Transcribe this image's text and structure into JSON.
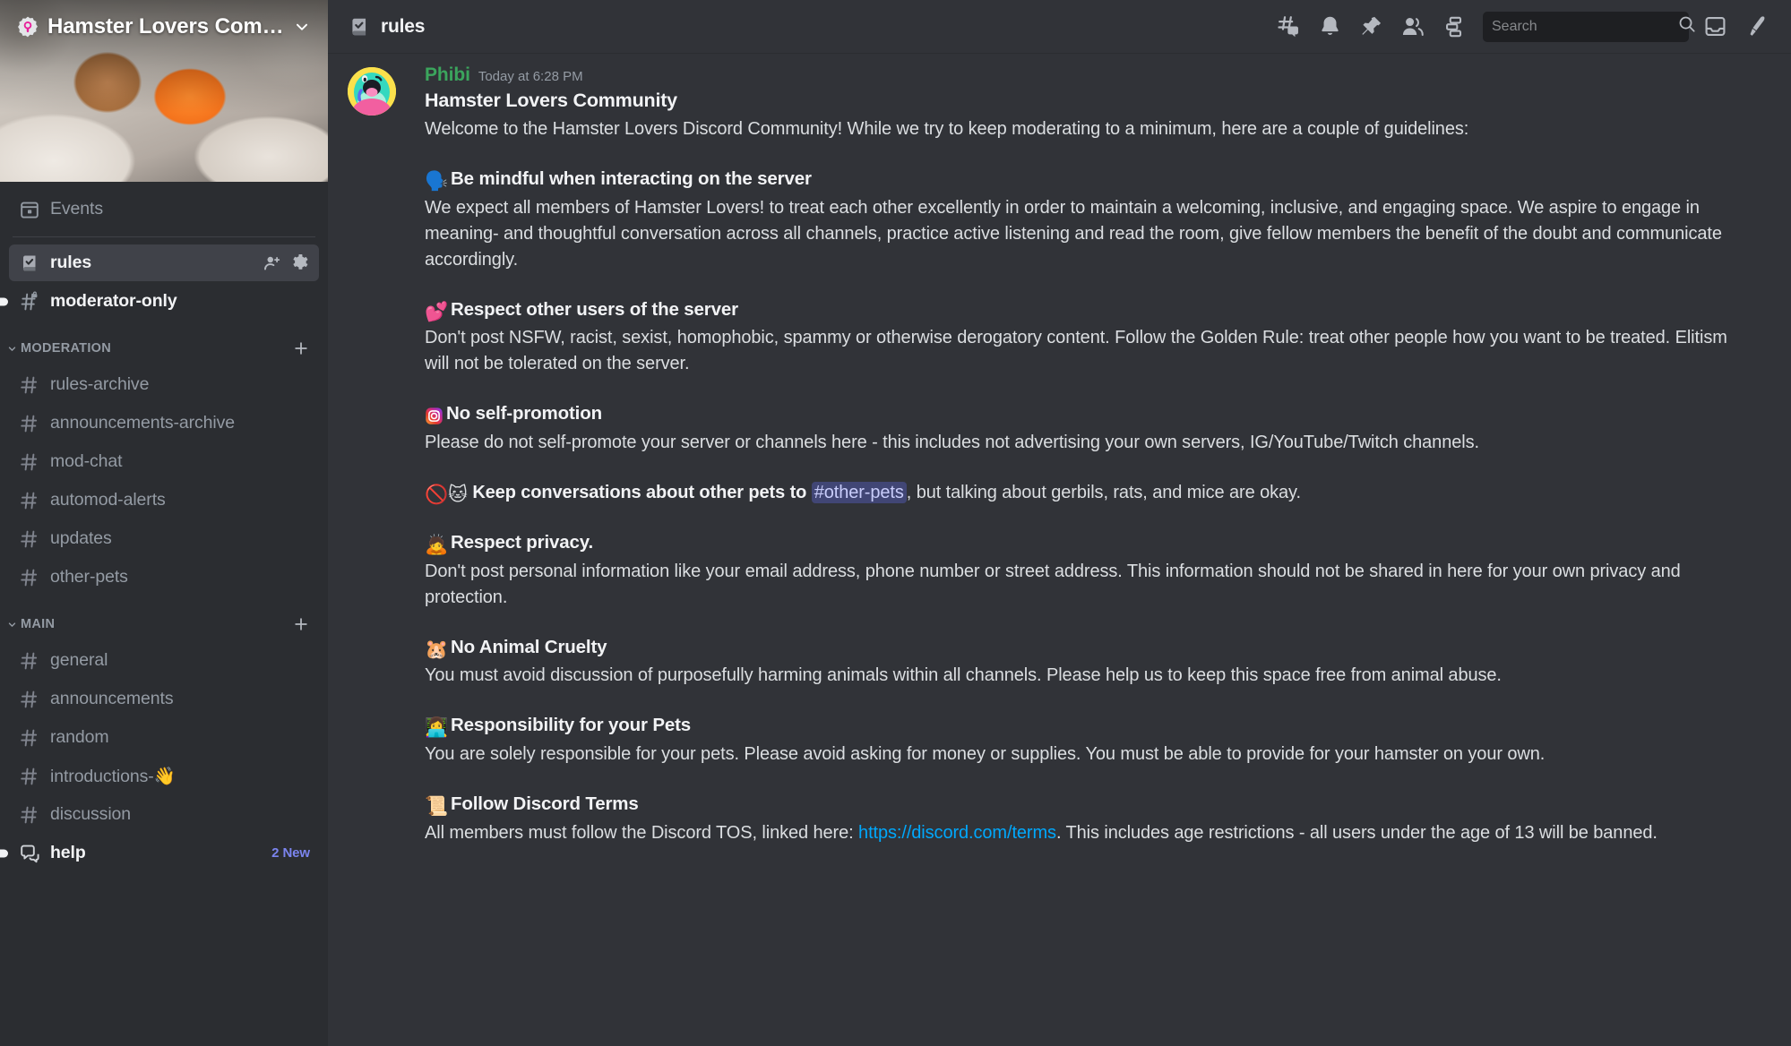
{
  "server": {
    "name": "Hamster Lovers Com…",
    "verified_icon": "verified-server-badge",
    "banner_alt": "hamster-holding-carrot-photo"
  },
  "sidebar": {
    "events_label": "Events",
    "top_channels": [
      {
        "label": "rules",
        "icon": "rules-book-icon",
        "selected": true,
        "unread": false,
        "actions": [
          "add-member-icon",
          "gear-icon"
        ]
      },
      {
        "label": "moderator-only",
        "icon": "hash-lock-icon",
        "selected": false,
        "unread": true,
        "actions": []
      }
    ],
    "categories": [
      {
        "name": "MODERATION",
        "add_icon": "plus-icon",
        "channels": [
          {
            "label": "rules-archive",
            "icon": "hash-icon"
          },
          {
            "label": "announcements-archive",
            "icon": "hash-icon"
          },
          {
            "label": "mod-chat",
            "icon": "hash-icon"
          },
          {
            "label": "automod-alerts",
            "icon": "hash-icon"
          },
          {
            "label": "updates",
            "icon": "hash-icon"
          },
          {
            "label": "other-pets",
            "icon": "hash-icon"
          }
        ]
      },
      {
        "name": "MAIN",
        "add_icon": "plus-icon",
        "channels": [
          {
            "label": "general",
            "icon": "hash-icon"
          },
          {
            "label": "announcements",
            "icon": "hash-icon"
          },
          {
            "label": "random",
            "icon": "hash-icon"
          },
          {
            "label": "introductions-👋",
            "icon": "hash-icon"
          },
          {
            "label": "discussion",
            "icon": "hash-icon"
          },
          {
            "label": "help",
            "icon": "forum-icon",
            "unread": true,
            "badge": "2 New"
          }
        ]
      }
    ]
  },
  "topbar": {
    "channel_name": "rules",
    "channel_icon": "rules-book-icon",
    "tools": [
      "threads-icon",
      "bell-icon",
      "pin-icon",
      "members-icon",
      "apps-icon"
    ],
    "right_tools": [
      "inbox-icon",
      "help-icon"
    ],
    "search": {
      "placeholder": "Search",
      "value": "",
      "icon": "search-icon"
    }
  },
  "message": {
    "author": "Phibi",
    "author_color": "#3ba55d",
    "timestamp": "Today at 6:28 PM",
    "avatar_alt": "phibi-character-avatar",
    "heading": "Hamster Lovers Community",
    "intro": "Welcome to the Hamster Lovers Discord Community! While we try to keep moderating to a minimum, here are a couple of guidelines:",
    "rules": [
      {
        "emoji": "🗣️",
        "emoji_name": "speaking-head-emoji",
        "title": "Be mindful when interacting on the server",
        "body": "We expect all members of Hamster Lovers! to treat each other excellently in order to maintain a welcoming, inclusive, and engaging space. We aspire to engage in meaning- and thoughtful conversation across all channels, practice active listening and read the room, give fellow members the benefit of the doubt and communicate accordingly."
      },
      {
        "emoji": "💕",
        "emoji_name": "two-hearts-emoji",
        "title": "Respect other users of the server",
        "body": "Don't post NSFW, racist, sexist, homophobic, spammy or otherwise derogatory content. Follow the Golden Rule: treat other people how you want to be treated. Elitism will not be tolerated on the server."
      },
      {
        "emoji": "📷",
        "emoji_name": "instagram-logo-emoji",
        "title": "No self-promotion",
        "body": "Please do not self-promote your server or channels here - this includes not advertising your own servers, IG/YouTube/Twitch channels."
      },
      {
        "inline": true,
        "emoji": "🚫🐱",
        "emoji_name": "prohibited-cat-emoji",
        "title_before": "Keep conversations about other pets to ",
        "mention": "#other-pets",
        "title_after": ", but talking about gerbils, rats, and mice are okay."
      },
      {
        "emoji": "🙇",
        "emoji_name": "bowing-person-emoji",
        "title": "Respect privacy.",
        "body": "Don't post personal information like your email address, phone number or street address. This information should not be shared in here for your own privacy and protection."
      },
      {
        "emoji": "🐹",
        "emoji_name": "hamster-emoji",
        "title": "No Animal Cruelty",
        "body": "You must avoid discussion of purposefully harming animals within all channels. Please help us to keep this space free from animal abuse."
      },
      {
        "emoji": "👩‍💻",
        "emoji_name": "person-at-computer-emoji",
        "title": "Responsibility for your Pets",
        "body": "You are solely responsible for your pets. Please avoid asking for money or supplies. You must be able to provide for your hamster on your own."
      },
      {
        "emoji": "📜",
        "emoji_name": "scroll-emoji",
        "title": "Follow Discord Terms",
        "body_before": "All members must follow the Discord TOS, linked here: ",
        "link_text": "https://discord.com/terms",
        "body_after": ". This includes age restrictions - all users under the age of 13 will be banned."
      }
    ]
  },
  "colors": {
    "sidebar_bg": "#2b2d31",
    "main_bg": "#313338",
    "selected_channel_bg": "#404249",
    "mention_bg": "#414675",
    "mention_fg": "#c9cdfb",
    "link": "#00a8fc",
    "badge_new": "#7b84ee",
    "author_green": "#3ba55d"
  }
}
